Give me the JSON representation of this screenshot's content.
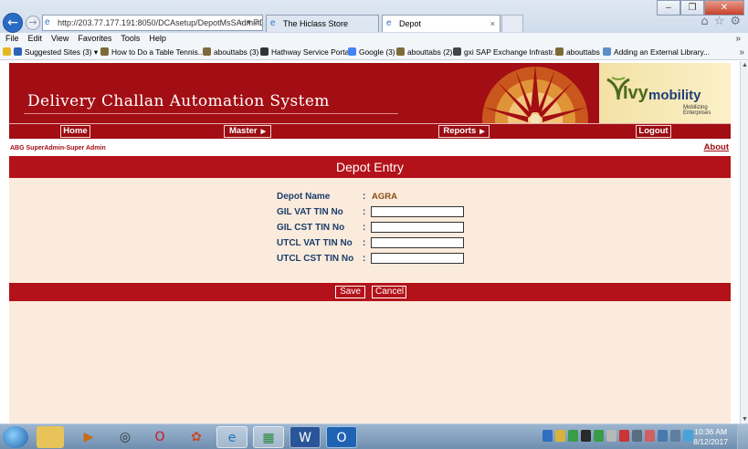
{
  "browser": {
    "url": "http://203.77.177.191:8050/DCAsetup/DepotMsSAdminD",
    "tabs": [
      {
        "label": "The Hiclass Store",
        "active": false
      },
      {
        "label": "Depot",
        "active": true
      }
    ],
    "menu": [
      "File",
      "Edit",
      "View",
      "Favorites",
      "Tools",
      "Help"
    ],
    "favorites": [
      "Suggested Sites (3) ▾",
      "How to Do a Table Tennis...",
      "abouttabs (3)",
      "Hathway Service Portal",
      "Google (3)",
      "abouttabs (2)",
      "gxi SAP Exchange Infrastr...",
      "abouttabs",
      "Adding an External Library..."
    ]
  },
  "app": {
    "title": "Delivery Challan Automation System",
    "logo_text_1": "Ivy",
    "logo_text_2": "mobility",
    "logo_tagline": "Mobilizing Enterprises",
    "nav": {
      "home": "Home",
      "master": "Master",
      "reports": "Reports",
      "logout": "Logout"
    },
    "user": "ABG SuperAdmin-Super Admin",
    "about": "About"
  },
  "form": {
    "heading": "Depot Entry",
    "depot_name_label": "Depot Name",
    "depot_name_value": "AGRA",
    "colon": ":",
    "fields": [
      {
        "label": "GIL VAT TIN No",
        "value": ""
      },
      {
        "label": "GIL CST TIN No",
        "value": ""
      },
      {
        "label": "UTCL VAT TIN No",
        "value": ""
      },
      {
        "label": "UTCL CST TIN No",
        "value": ""
      }
    ],
    "save_label": "Save",
    "cancel_label": "Cancel"
  },
  "taskbar": {
    "time": "10:36 AM",
    "date": "8/12/2017"
  },
  "colors": {
    "brand_red": "#a20e14",
    "form_bg": "#fbebdc",
    "label_blue": "#1a3d6b"
  }
}
